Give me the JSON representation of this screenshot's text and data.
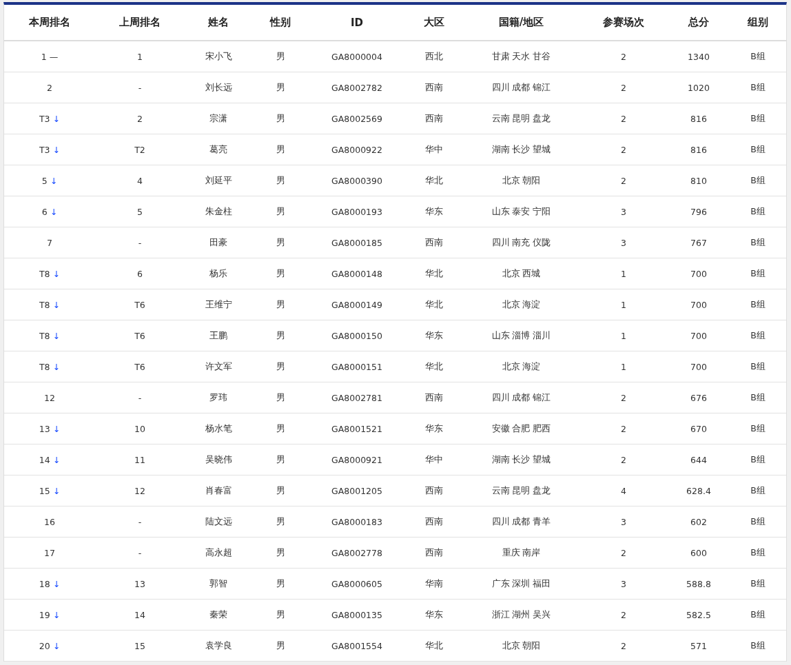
{
  "table": {
    "columns": [
      "本周排名",
      "上周排名",
      "姓名",
      "性别",
      "ID",
      "大区",
      "国籍/地区",
      "参赛场次",
      "总分",
      "组别"
    ],
    "rows": [
      {
        "this_week": "1",
        "trend": {
          "symbol": "—",
          "kind": "same"
        },
        "last_week": "1",
        "name": "宋小飞",
        "gender": "男",
        "id": "GA8000004",
        "region": "西北",
        "location": "甘肃 天水 甘谷",
        "matches": "2",
        "total": "1340",
        "group": "B组"
      },
      {
        "this_week": "2",
        "last_week": "-",
        "name": "刘长远",
        "gender": "男",
        "id": "GA8002782",
        "region": "西南",
        "location": "四川 成都 锦江",
        "matches": "2",
        "total": "1020",
        "group": "B组"
      },
      {
        "this_week": "T3",
        "trend": {
          "symbol": "↓",
          "kind": "down"
        },
        "last_week": "2",
        "name": "宗潇",
        "gender": "男",
        "id": "GA8002569",
        "region": "西南",
        "location": "云南 昆明 盘龙",
        "matches": "2",
        "total": "816",
        "group": "B组"
      },
      {
        "this_week": "T3",
        "trend": {
          "symbol": "↓",
          "kind": "down"
        },
        "last_week": "T2",
        "name": "葛亮",
        "gender": "男",
        "id": "GA8000922",
        "region": "华中",
        "location": "湖南 长沙 望城",
        "matches": "2",
        "total": "816",
        "group": "B组"
      },
      {
        "this_week": "5",
        "trend": {
          "symbol": "↓",
          "kind": "down"
        },
        "last_week": "4",
        "name": "刘延平",
        "gender": "男",
        "id": "GA8000390",
        "region": "华北",
        "location": "北京 朝阳",
        "matches": "2",
        "total": "810",
        "group": "B组"
      },
      {
        "this_week": "6",
        "trend": {
          "symbol": "↓",
          "kind": "down"
        },
        "last_week": "5",
        "name": "朱金柱",
        "gender": "男",
        "id": "GA8000193",
        "region": "华东",
        "location": "山东 泰安 宁阳",
        "matches": "3",
        "total": "796",
        "group": "B组"
      },
      {
        "this_week": "7",
        "last_week": "-",
        "name": "田豪",
        "gender": "男",
        "id": "GA8000185",
        "region": "西南",
        "location": "四川 南充 仪陇",
        "matches": "3",
        "total": "767",
        "group": "B组"
      },
      {
        "this_week": "T8",
        "trend": {
          "symbol": "↓",
          "kind": "down"
        },
        "last_week": "6",
        "name": "杨乐",
        "gender": "男",
        "id": "GA8000148",
        "region": "华北",
        "location": "北京 西城",
        "matches": "1",
        "total": "700",
        "group": "B组"
      },
      {
        "this_week": "T8",
        "trend": {
          "symbol": "↓",
          "kind": "down"
        },
        "last_week": "T6",
        "name": "王维宁",
        "gender": "男",
        "id": "GA8000149",
        "region": "华北",
        "location": "北京 海淀",
        "matches": "1",
        "total": "700",
        "group": "B组"
      },
      {
        "this_week": "T8",
        "trend": {
          "symbol": "↓",
          "kind": "down"
        },
        "last_week": "T6",
        "name": "王鹏",
        "gender": "男",
        "id": "GA8000150",
        "region": "华东",
        "location": "山东 淄博 淄川",
        "matches": "1",
        "total": "700",
        "group": "B组"
      },
      {
        "this_week": "T8",
        "trend": {
          "symbol": "↓",
          "kind": "down"
        },
        "last_week": "T6",
        "name": "许文军",
        "gender": "男",
        "id": "GA8000151",
        "region": "华北",
        "location": "北京 海淀",
        "matches": "1",
        "total": "700",
        "group": "B组"
      },
      {
        "this_week": "12",
        "last_week": "-",
        "name": "罗玮",
        "gender": "男",
        "id": "GA8002781",
        "region": "西南",
        "location": "四川 成都 锦江",
        "matches": "2",
        "total": "676",
        "group": "B组"
      },
      {
        "this_week": "13",
        "trend": {
          "symbol": "↓",
          "kind": "down"
        },
        "last_week": "10",
        "name": "杨水笔",
        "gender": "男",
        "id": "GA8001521",
        "region": "华东",
        "location": "安徽 合肥 肥西",
        "matches": "2",
        "total": "670",
        "group": "B组"
      },
      {
        "this_week": "14",
        "trend": {
          "symbol": "↓",
          "kind": "down"
        },
        "last_week": "11",
        "name": "吴晓伟",
        "gender": "男",
        "id": "GA8000921",
        "region": "华中",
        "location": "湖南 长沙 望城",
        "matches": "2",
        "total": "644",
        "group": "B组"
      },
      {
        "this_week": "15",
        "trend": {
          "symbol": "↓",
          "kind": "down"
        },
        "last_week": "12",
        "name": "肖春富",
        "gender": "男",
        "id": "GA8001205",
        "region": "西南",
        "location": "云南 昆明 盘龙",
        "matches": "4",
        "total": "628.4",
        "group": "B组"
      },
      {
        "this_week": "16",
        "last_week": "-",
        "name": "陆文远",
        "gender": "男",
        "id": "GA8000183",
        "region": "西南",
        "location": "四川 成都 青羊",
        "matches": "3",
        "total": "602",
        "group": "B组"
      },
      {
        "this_week": "17",
        "last_week": "-",
        "name": "高永超",
        "gender": "男",
        "id": "GA8002778",
        "region": "西南",
        "location": "重庆 南岸",
        "matches": "2",
        "total": "600",
        "group": "B组"
      },
      {
        "this_week": "18",
        "trend": {
          "symbol": "↓",
          "kind": "down"
        },
        "last_week": "13",
        "name": "郭智",
        "gender": "男",
        "id": "GA8000605",
        "region": "华南",
        "location": "广东 深圳 福田",
        "matches": "3",
        "total": "588.8",
        "group": "B组"
      },
      {
        "this_week": "19",
        "trend": {
          "symbol": "↓",
          "kind": "down"
        },
        "last_week": "14",
        "name": "秦荣",
        "gender": "男",
        "id": "GA8000135",
        "region": "华东",
        "location": "浙江 湖州 吴兴",
        "matches": "2",
        "total": "582.5",
        "group": "B组"
      },
      {
        "this_week": "20",
        "trend": {
          "symbol": "↓",
          "kind": "down"
        },
        "last_week": "15",
        "name": "袁学良",
        "gender": "男",
        "id": "GA8001554",
        "region": "华北",
        "location": "北京 朝阳",
        "matches": "2",
        "total": "571",
        "group": "B组"
      }
    ]
  }
}
